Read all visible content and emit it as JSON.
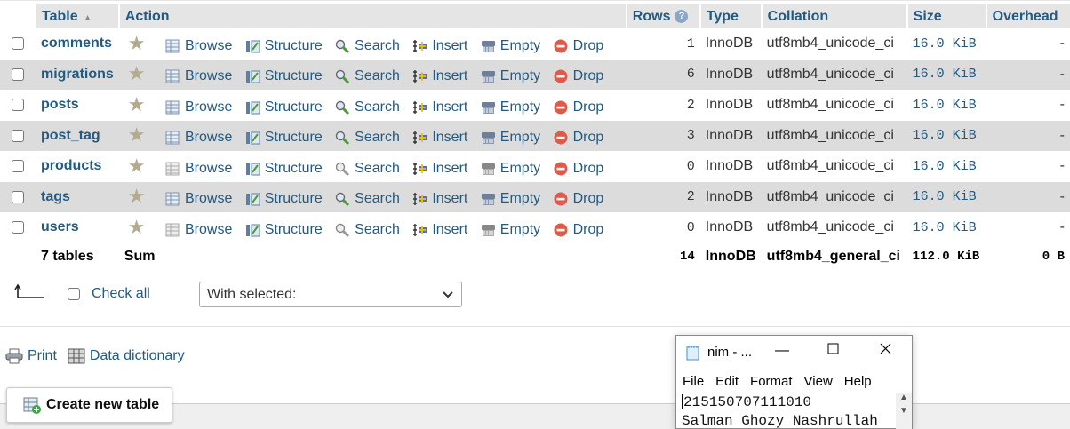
{
  "table": {
    "headers": {
      "table": "Table",
      "action": "Action",
      "rows": "Rows",
      "type": "Type",
      "collation": "Collation",
      "size": "Size",
      "overhead": "Overhead"
    },
    "actions": {
      "browse": "Browse",
      "structure": "Structure",
      "search": "Search",
      "insert": "Insert",
      "empty": "Empty",
      "drop": "Drop"
    },
    "rows": [
      {
        "name": "comments",
        "rows": "1",
        "type": "InnoDB",
        "collation": "utf8mb4_unicode_ci",
        "size": "16.0 KiB",
        "overhead": "-"
      },
      {
        "name": "migrations",
        "rows": "6",
        "type": "InnoDB",
        "collation": "utf8mb4_unicode_ci",
        "size": "16.0 KiB",
        "overhead": "-"
      },
      {
        "name": "posts",
        "rows": "2",
        "type": "InnoDB",
        "collation": "utf8mb4_unicode_ci",
        "size": "16.0 KiB",
        "overhead": "-"
      },
      {
        "name": "post_tag",
        "rows": "3",
        "type": "InnoDB",
        "collation": "utf8mb4_unicode_ci",
        "size": "16.0 KiB",
        "overhead": "-"
      },
      {
        "name": "products",
        "rows": "0",
        "type": "InnoDB",
        "collation": "utf8mb4_unicode_ci",
        "size": "16.0 KiB",
        "overhead": "-"
      },
      {
        "name": "tags",
        "rows": "2",
        "type": "InnoDB",
        "collation": "utf8mb4_unicode_ci",
        "size": "16.0 KiB",
        "overhead": "-"
      },
      {
        "name": "users",
        "rows": "0",
        "type": "InnoDB",
        "collation": "utf8mb4_unicode_ci",
        "size": "16.0 KiB",
        "overhead": "-"
      }
    ],
    "footer": {
      "count": "7 tables",
      "sum": "Sum",
      "rows": "14",
      "type": "InnoDB",
      "collation": "utf8mb4_general_ci",
      "size": "112.0 KiB",
      "overhead": "0 B"
    }
  },
  "bulk": {
    "check_all": "Check all",
    "with_selected": "With selected:"
  },
  "links": {
    "print": "Print",
    "data_dictionary": "Data dictionary"
  },
  "create_table": "Create new table",
  "notepad": {
    "title": "nim - ...",
    "menu": [
      "File",
      "Edit",
      "Format",
      "View",
      "Help"
    ],
    "lines": [
      "215150707111010",
      "Salman Ghozy Nashrullah"
    ]
  },
  "colors": {
    "link": "#235a81",
    "header_bg": "#e5e5e5",
    "alt_row": "#dcdcdc",
    "drop_red": "#e05a4a"
  }
}
